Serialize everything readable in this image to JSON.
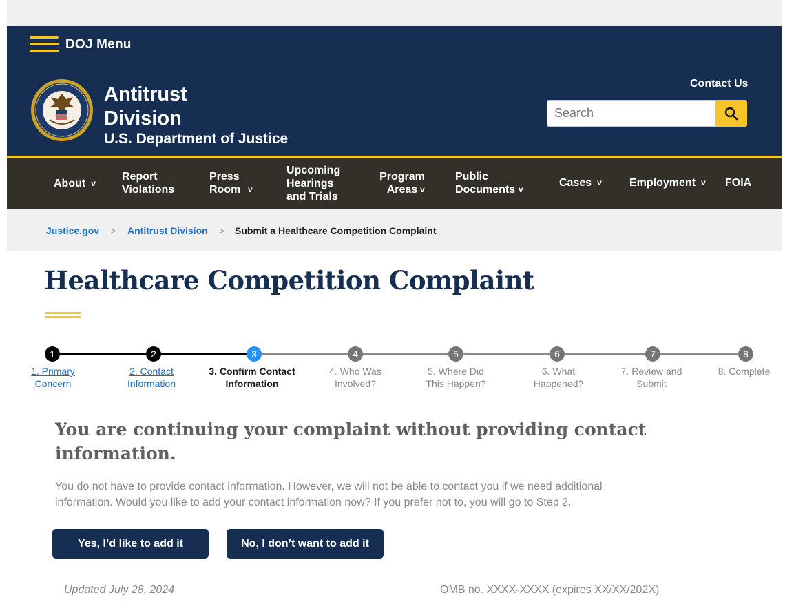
{
  "header": {
    "menu_label": "DOJ Menu",
    "title_line1": "Antitrust",
    "title_line2": "Division",
    "subtitle": "U.S. Department of Justice",
    "contact_label": "Contact Us",
    "search_placeholder": "Search"
  },
  "nav": {
    "items": [
      {
        "label": "About",
        "has_caret": true
      },
      {
        "label": "Report Violations",
        "has_caret": false
      },
      {
        "label": "Press Room",
        "has_caret": true
      },
      {
        "label": "Upcoming Hearings and Trials",
        "has_caret": false
      },
      {
        "label": "Program Areas",
        "has_caret": true
      },
      {
        "label": "Public Documents",
        "has_caret": true
      },
      {
        "label": "Cases",
        "has_caret": true
      },
      {
        "label": "Employment",
        "has_caret": true
      },
      {
        "label": "FOIA",
        "has_caret": false
      }
    ],
    "caret_glyph": "v"
  },
  "breadcrumb": {
    "items": [
      "Justice.gov",
      "Antitrust Division",
      "Submit a Healthcare Competition Complaint"
    ],
    "separator": ">"
  },
  "page": {
    "title": "Healthcare Competition Complaint"
  },
  "stepper": {
    "steps": [
      {
        "number": "1",
        "label_1": "1. Primary",
        "label_2": "Concern",
        "state": "done"
      },
      {
        "number": "2",
        "label_1": "2. Contact",
        "label_2": "Information",
        "state": "done"
      },
      {
        "number": "3",
        "label_1": "3. Confirm Contact",
        "label_2": "Information",
        "state": "active"
      },
      {
        "number": "4",
        "label_1": "4. Who Was",
        "label_2": "Involved?",
        "state": "todo"
      },
      {
        "number": "5",
        "label_1": "5. Where Did",
        "label_2": "This Happen?",
        "state": "todo"
      },
      {
        "number": "6",
        "label_1": "6. What",
        "label_2": "Happened?",
        "state": "todo"
      },
      {
        "number": "7",
        "label_1": "7. Review and",
        "label_2": "Submit",
        "state": "todo"
      },
      {
        "number": "8",
        "label_1": "8. Complete",
        "label_2": "",
        "state": "todo"
      }
    ]
  },
  "notice": {
    "title": "You are continuing your complaint without providing contact information.",
    "body": "You do not have to provide contact information. However, we will not be able to contact you if we need additional information. Would you like to add your contact information now? If you prefer not to, you will go to Step 2."
  },
  "actions": {
    "yes_label": "Yes, I’d like to add it",
    "no_label": "No, I don’t want to add it"
  },
  "footer": {
    "updated": "Updated July 28, 2024",
    "omb": "OMB no. XXXX-XXXX (expires XX/XX/202X)"
  },
  "colors": {
    "navy": "#162e51",
    "gold": "#f5c52a",
    "nav_bg": "#33302a",
    "link_blue": "#1a73c9",
    "active_step": "#2491ff",
    "done_step": "#000000",
    "todo_step": "#757575"
  }
}
